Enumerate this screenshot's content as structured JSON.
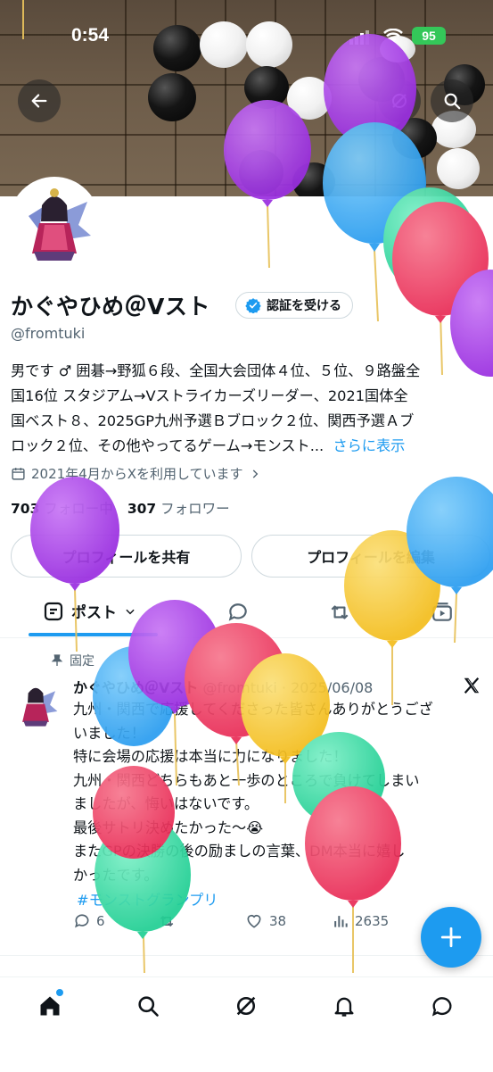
{
  "status_bar": {
    "time": "0:54",
    "battery": "95"
  },
  "profile": {
    "display_name": "かぐやひめ＠Vスト",
    "verify_label": "認証を受ける",
    "handle": "@fromtuki",
    "bio_lines": [
      "男です ♂ 囲碁→野狐６段、全国大会団体４位、５位、９路盤全",
      "国16位 スタジアム→Vストライカーズリーダー、2021国体全",
      "国ベスト８、2025GP九州予選Ｂブロック２位、関西予選Ａブ",
      "ロック２位、その他やってるゲーム→モンスト..."
    ],
    "bio_more": "さらに表示",
    "joined": "2021年4月からXを利用しています",
    "following_count": "703",
    "following_label": "フォロー中",
    "followers_count": "307",
    "followers_label": "フォロワー",
    "share_label": "プロフィールを共有",
    "edit_label": "プロフィールを編集"
  },
  "tabs": {
    "posts_label": "ポスト"
  },
  "tweet": {
    "pinned_label": "固定",
    "author": "かぐやひめ＠Vスト",
    "handle_date": "@fromtuki · 2025/06/08",
    "lines": [
      "九州・関西で応援してくださった皆さんありがとうござ",
      "いました！",
      "特に会場の応援は本当に力になりました！",
      "九州・関西どちらもあと一歩のところで負けてしまい",
      "ましたが、悔いはないです。",
      "最後サトリ決めたかった〜😭",
      "またGPの決勝の後の励ましの言葉、DM本当に嬉し",
      "かったです。"
    ],
    "hashtag": "#モンストグランプリ",
    "replies": "6",
    "likes": "38",
    "views": "2635"
  },
  "colors": {
    "accent": "#1d9bf0",
    "battery": "#34c759",
    "balloon_purple": "#a335e6",
    "balloon_blue": "#33a8f5",
    "balloon_red": "#ee3860",
    "balloon_yellow": "#f7c72e",
    "balloon_green": "#34d6a0"
  },
  "icons": [
    "back-arrow-icon",
    "grok-icon",
    "search-icon",
    "verified-badge-icon",
    "calendar-icon",
    "chevron-right-icon",
    "posts-tab-icon",
    "chevron-down-icon",
    "replies-tab-icon",
    "reposts-tab-icon",
    "video-tab-icon",
    "pin-icon",
    "x-logo-icon",
    "reply-icon",
    "repost-icon",
    "like-icon",
    "views-icon",
    "compose-plus-icon",
    "home-icon",
    "explore-icon",
    "grok-nav-icon",
    "notifications-icon",
    "messages-icon"
  ]
}
